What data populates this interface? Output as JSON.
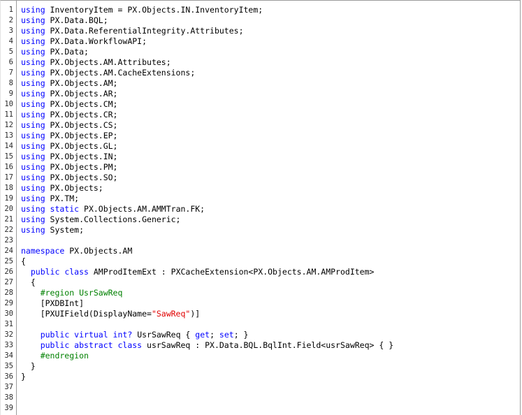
{
  "editor": {
    "lines": [
      {
        "n": "1",
        "segs": [
          [
            "kw",
            "using"
          ],
          [
            "pl",
            " InventoryItem = PX.Objects.IN.InventoryItem;"
          ]
        ]
      },
      {
        "n": "2",
        "segs": [
          [
            "kw",
            "using"
          ],
          [
            "pl",
            " PX.Data.BQL;"
          ]
        ]
      },
      {
        "n": "3",
        "segs": [
          [
            "kw",
            "using"
          ],
          [
            "pl",
            " PX.Data.ReferentialIntegrity.Attributes;"
          ]
        ]
      },
      {
        "n": "4",
        "segs": [
          [
            "kw",
            "using"
          ],
          [
            "pl",
            " PX.Data.WorkflowAPI;"
          ]
        ]
      },
      {
        "n": "5",
        "segs": [
          [
            "kw",
            "using"
          ],
          [
            "pl",
            " PX.Data;"
          ]
        ]
      },
      {
        "n": "6",
        "segs": [
          [
            "kw",
            "using"
          ],
          [
            "pl",
            " PX.Objects.AM.Attributes;"
          ]
        ]
      },
      {
        "n": "7",
        "segs": [
          [
            "kw",
            "using"
          ],
          [
            "pl",
            " PX.Objects.AM.CacheExtensions;"
          ]
        ]
      },
      {
        "n": "8",
        "segs": [
          [
            "kw",
            "using"
          ],
          [
            "pl",
            " PX.Objects.AM;"
          ]
        ]
      },
      {
        "n": "9",
        "segs": [
          [
            "kw",
            "using"
          ],
          [
            "pl",
            " PX.Objects.AR;"
          ]
        ]
      },
      {
        "n": "10",
        "segs": [
          [
            "kw",
            "using"
          ],
          [
            "pl",
            " PX.Objects.CM;"
          ]
        ]
      },
      {
        "n": "11",
        "segs": [
          [
            "kw",
            "using"
          ],
          [
            "pl",
            " PX.Objects.CR;"
          ]
        ]
      },
      {
        "n": "12",
        "segs": [
          [
            "kw",
            "using"
          ],
          [
            "pl",
            " PX.Objects.CS;"
          ]
        ]
      },
      {
        "n": "13",
        "segs": [
          [
            "kw",
            "using"
          ],
          [
            "pl",
            " PX.Objects.EP;"
          ]
        ]
      },
      {
        "n": "14",
        "segs": [
          [
            "kw",
            "using"
          ],
          [
            "pl",
            " PX.Objects.GL;"
          ]
        ]
      },
      {
        "n": "15",
        "segs": [
          [
            "kw",
            "using"
          ],
          [
            "pl",
            " PX.Objects.IN;"
          ]
        ]
      },
      {
        "n": "16",
        "segs": [
          [
            "kw",
            "using"
          ],
          [
            "pl",
            " PX.Objects.PM;"
          ]
        ]
      },
      {
        "n": "17",
        "segs": [
          [
            "kw",
            "using"
          ],
          [
            "pl",
            " PX.Objects.SO;"
          ]
        ]
      },
      {
        "n": "18",
        "segs": [
          [
            "kw",
            "using"
          ],
          [
            "pl",
            " PX.Objects;"
          ]
        ]
      },
      {
        "n": "19",
        "segs": [
          [
            "kw",
            "using"
          ],
          [
            "pl",
            " PX.TM;"
          ]
        ]
      },
      {
        "n": "20",
        "segs": [
          [
            "kw",
            "using static"
          ],
          [
            "pl",
            " PX.Objects.AM.AMMTran.FK;"
          ]
        ]
      },
      {
        "n": "21",
        "segs": [
          [
            "kw",
            "using"
          ],
          [
            "pl",
            " System.Collections.Generic;"
          ]
        ]
      },
      {
        "n": "22",
        "segs": [
          [
            "kw",
            "using"
          ],
          [
            "pl",
            " System;"
          ]
        ]
      },
      {
        "n": "23",
        "segs": []
      },
      {
        "n": "24",
        "segs": [
          [
            "kw",
            "namespace"
          ],
          [
            "pl",
            " PX.Objects.AM"
          ]
        ]
      },
      {
        "n": "25",
        "segs": [
          [
            "pl",
            "{"
          ]
        ]
      },
      {
        "n": "26",
        "segs": [
          [
            "pl",
            "  "
          ],
          [
            "kw",
            "public class"
          ],
          [
            "pl",
            " AMProdItemExt : PXCacheExtension<PX.Objects.AM.AMProdItem>"
          ]
        ]
      },
      {
        "n": "27",
        "segs": [
          [
            "pl",
            "  {"
          ]
        ]
      },
      {
        "n": "28",
        "segs": [
          [
            "pp",
            "    #region UsrSawReq"
          ]
        ]
      },
      {
        "n": "29",
        "segs": [
          [
            "pl",
            "    [PXDBInt]"
          ]
        ]
      },
      {
        "n": "30",
        "segs": [
          [
            "pl",
            "    [PXUIField(DisplayName="
          ],
          [
            "str",
            "\"SawReq\""
          ],
          [
            "pl",
            ")]"
          ]
        ]
      },
      {
        "n": "31",
        "segs": []
      },
      {
        "n": "32",
        "segs": [
          [
            "pl",
            "    "
          ],
          [
            "kw",
            "public virtual int?"
          ],
          [
            "pl",
            " UsrSawReq { "
          ],
          [
            "kw",
            "get"
          ],
          [
            "pl",
            "; "
          ],
          [
            "kw",
            "set"
          ],
          [
            "pl",
            "; }"
          ]
        ]
      },
      {
        "n": "33",
        "segs": [
          [
            "pl",
            "    "
          ],
          [
            "kw",
            "public abstract class"
          ],
          [
            "pl",
            " usrSawReq : PX.Data.BQL.BqlInt.Field<usrSawReq> { }"
          ]
        ]
      },
      {
        "n": "34",
        "segs": [
          [
            "pp",
            "    #endregion"
          ]
        ]
      },
      {
        "n": "35",
        "segs": [
          [
            "pl",
            "  }"
          ]
        ]
      },
      {
        "n": "36",
        "segs": [
          [
            "pl",
            "}"
          ]
        ]
      },
      {
        "n": "37",
        "segs": []
      },
      {
        "n": "38",
        "segs": []
      },
      {
        "n": "39",
        "segs": []
      }
    ]
  }
}
